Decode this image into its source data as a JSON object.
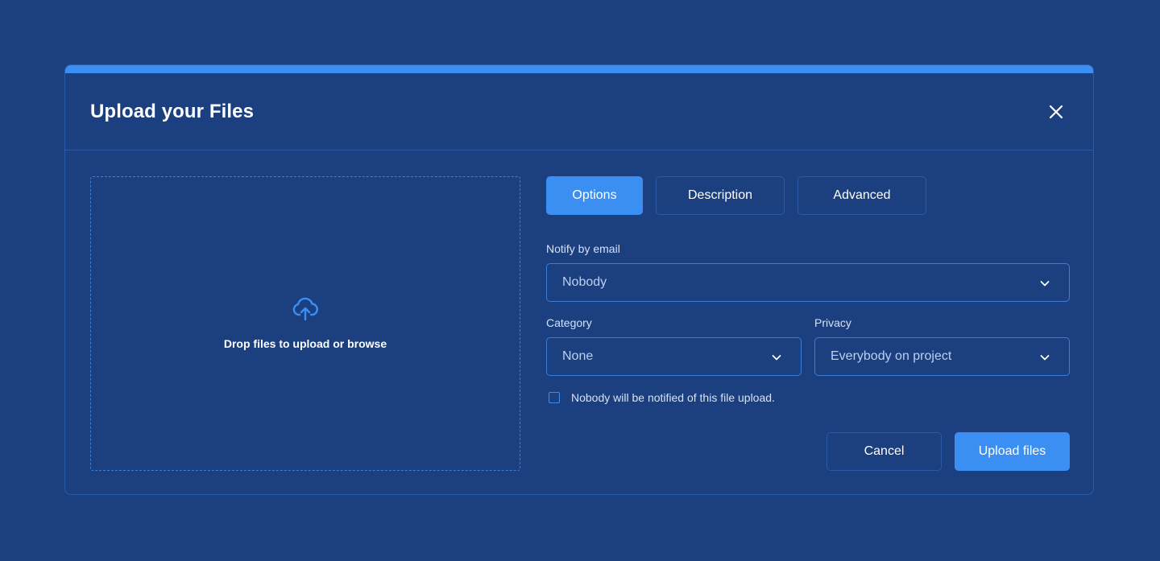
{
  "colors": {
    "background": "#1b3f7f",
    "accent": "#3b8ff3",
    "border": "#2c5aa5",
    "text": "#ffffff",
    "muted_text": "#bcd0f2"
  },
  "modal": {
    "title": "Upload your Files",
    "close_icon": "close-icon"
  },
  "dropzone": {
    "icon": "cloud-upload-icon",
    "text": "Drop files to upload or browse"
  },
  "tabs": [
    {
      "label": "Options",
      "active": true
    },
    {
      "label": "Description",
      "active": false
    },
    {
      "label": "Advanced",
      "active": false
    }
  ],
  "form": {
    "notify": {
      "label": "Notify by email",
      "value": "Nobody"
    },
    "category": {
      "label": "Category",
      "value": "None"
    },
    "privacy": {
      "label": "Privacy",
      "value": "Everybody on project"
    },
    "notice": {
      "checked": false,
      "label": "Nobody will be notified of this file upload."
    }
  },
  "actions": {
    "cancel_label": "Cancel",
    "upload_label": "Upload files"
  }
}
